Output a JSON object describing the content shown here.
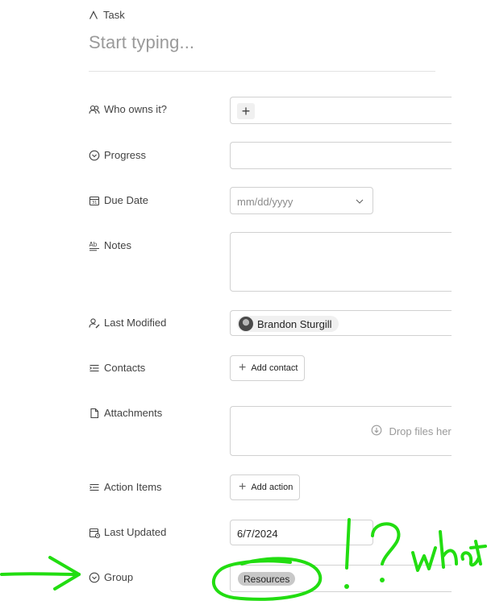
{
  "header": {
    "item_type": "Task",
    "title_placeholder": "Start typing..."
  },
  "fields": {
    "owner": {
      "label": "Who owns it?",
      "add_icon": "plus-icon"
    },
    "progress": {
      "label": "Progress"
    },
    "due_date": {
      "label": "Due Date",
      "placeholder": "mm/dd/yyyy"
    },
    "notes": {
      "label": "Notes"
    },
    "last_modified": {
      "label": "Last Modified",
      "person": "Brandon Sturgill"
    },
    "contacts": {
      "label": "Contacts",
      "button": "Add contact"
    },
    "attachments": {
      "label": "Attachments",
      "drop_text": "Drop files here"
    },
    "action_items": {
      "label": "Action Items",
      "button": "Add action"
    },
    "last_updated": {
      "label": "Last Updated",
      "value": "6/7/2024"
    },
    "group": {
      "label": "Group",
      "tag": "Resources"
    }
  },
  "annotation": {
    "text": "what",
    "marks": "!?",
    "color": "#22dd11"
  }
}
